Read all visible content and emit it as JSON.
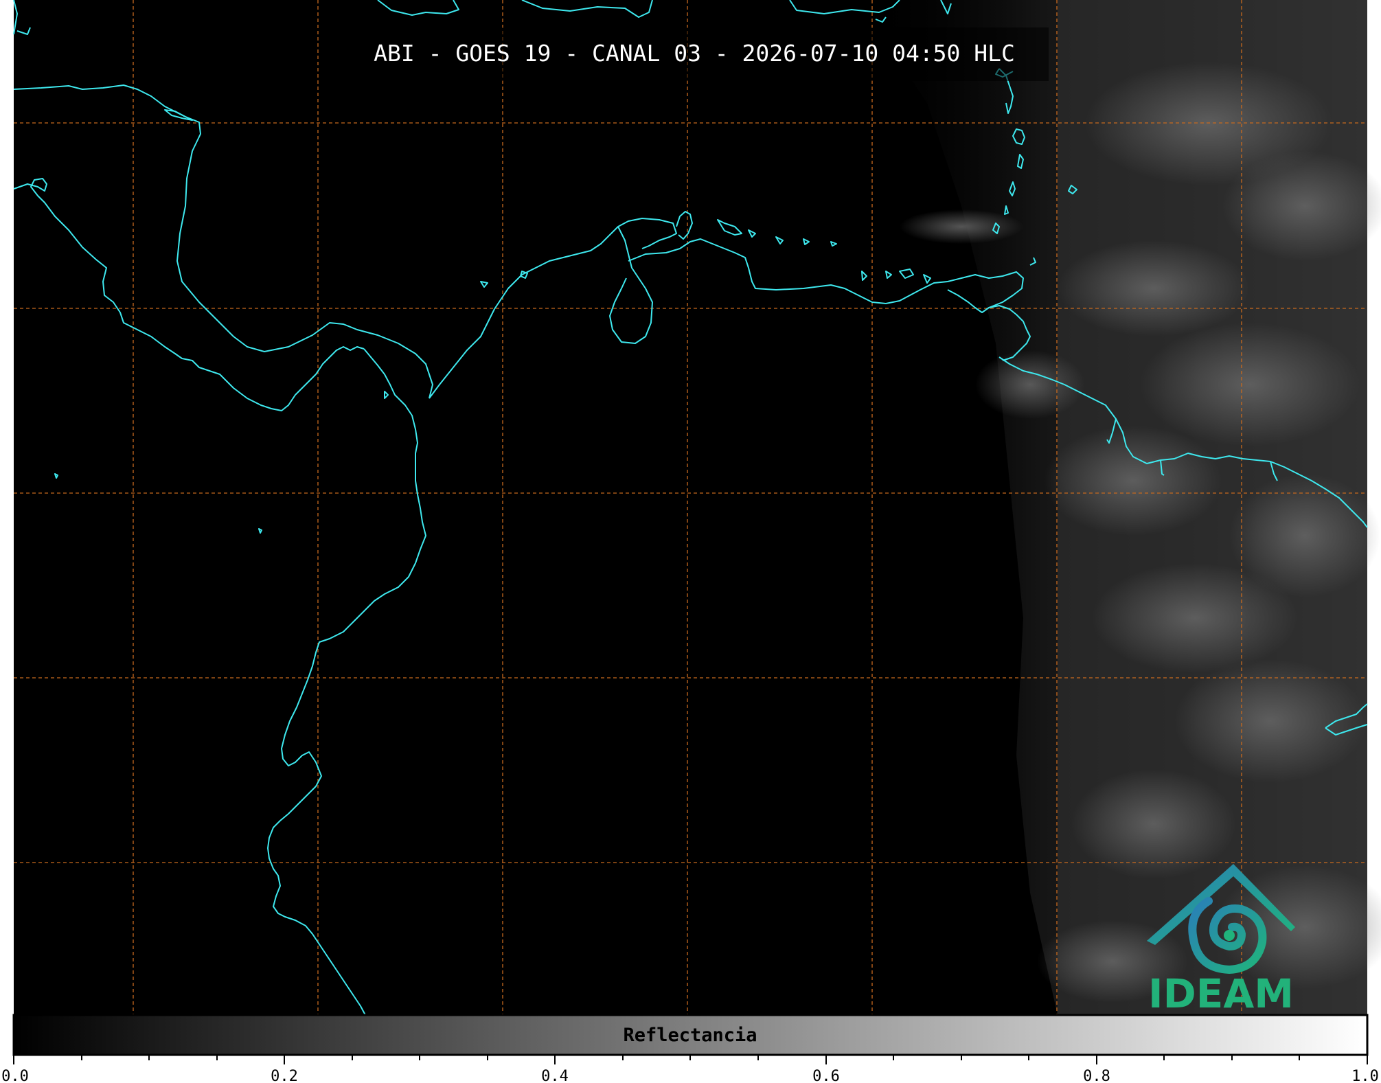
{
  "title": "ABI - GOES 19 - CANAL 03 - 2026-07-10 04:50 HLC",
  "colorbar": {
    "label": "Reflectancia",
    "ticks": [
      "0.0",
      "0.2",
      "0.4",
      "0.6",
      "0.8",
      "1.0"
    ],
    "range": [
      0.0,
      1.0
    ],
    "colormap": "grayscale"
  },
  "logo": {
    "name": "IDEAM"
  },
  "colors": {
    "coastline": "#3ee8ee",
    "grid": "#c86a1e",
    "background": "#000000"
  }
}
